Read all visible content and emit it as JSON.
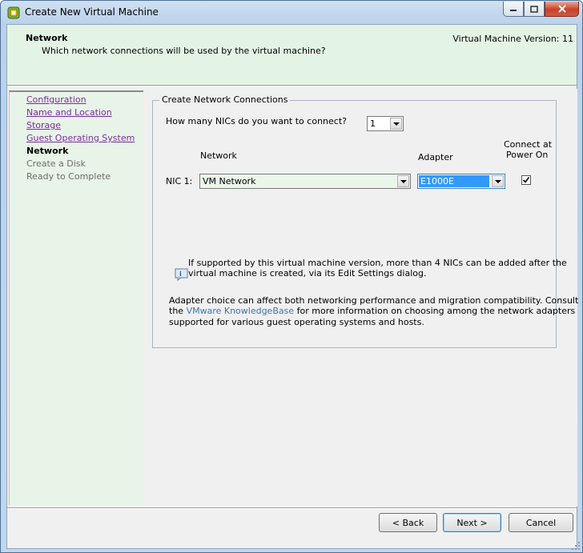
{
  "window": {
    "title": "Create New Virtual Machine"
  },
  "header": {
    "title": "Network",
    "subtitle": "Which network connections will be used by the virtual machine?",
    "version": "Virtual Machine Version: 11"
  },
  "sidebar": {
    "steps": [
      {
        "label": "Configuration",
        "state": "link"
      },
      {
        "label": "Name and Location",
        "state": "link"
      },
      {
        "label": "Storage",
        "state": "link"
      },
      {
        "label": "Guest Operating System",
        "state": "link"
      },
      {
        "label": "Network",
        "state": "current"
      },
      {
        "label": "Create a Disk",
        "state": "disabled"
      },
      {
        "label": "Ready to Complete",
        "state": "disabled"
      }
    ]
  },
  "group": {
    "legend": "Create Network Connections",
    "nic_count_question": "How many NICs do you want to connect?",
    "nic_count_value": "1",
    "col_network": "Network",
    "col_adapter": "Adapter",
    "col_connect_line1": "Connect at",
    "col_connect_line2": "Power On",
    "nic1_label": "NIC 1:",
    "nic1_network": "VM Network",
    "nic1_adapter": "E1000E",
    "nic1_connect_checked": true,
    "info_line1": "If supported by this virtual machine version, more than 4 NICs can be added after the",
    "info_line2": "virtual machine is created, via its Edit Settings dialog.",
    "adapter_line1": "Adapter choice can affect both networking performance and migration compatibility. Consult",
    "adapter_line2_prefix": "the ",
    "adapter_link": "VMware KnowledgeBase",
    "adapter_line2_suffix": " for more information on choosing among the network adapters",
    "adapter_line3": "supported for various guest operating systems and hosts."
  },
  "buttons": {
    "back": "< Back",
    "next": "Next >",
    "cancel": "Cancel"
  },
  "colors": {
    "header_bg": "#e4f4e4",
    "sidebar_bg": "#e8f4e8",
    "link": "#7a2ca0",
    "adapter_highlight": "#3399ff"
  }
}
